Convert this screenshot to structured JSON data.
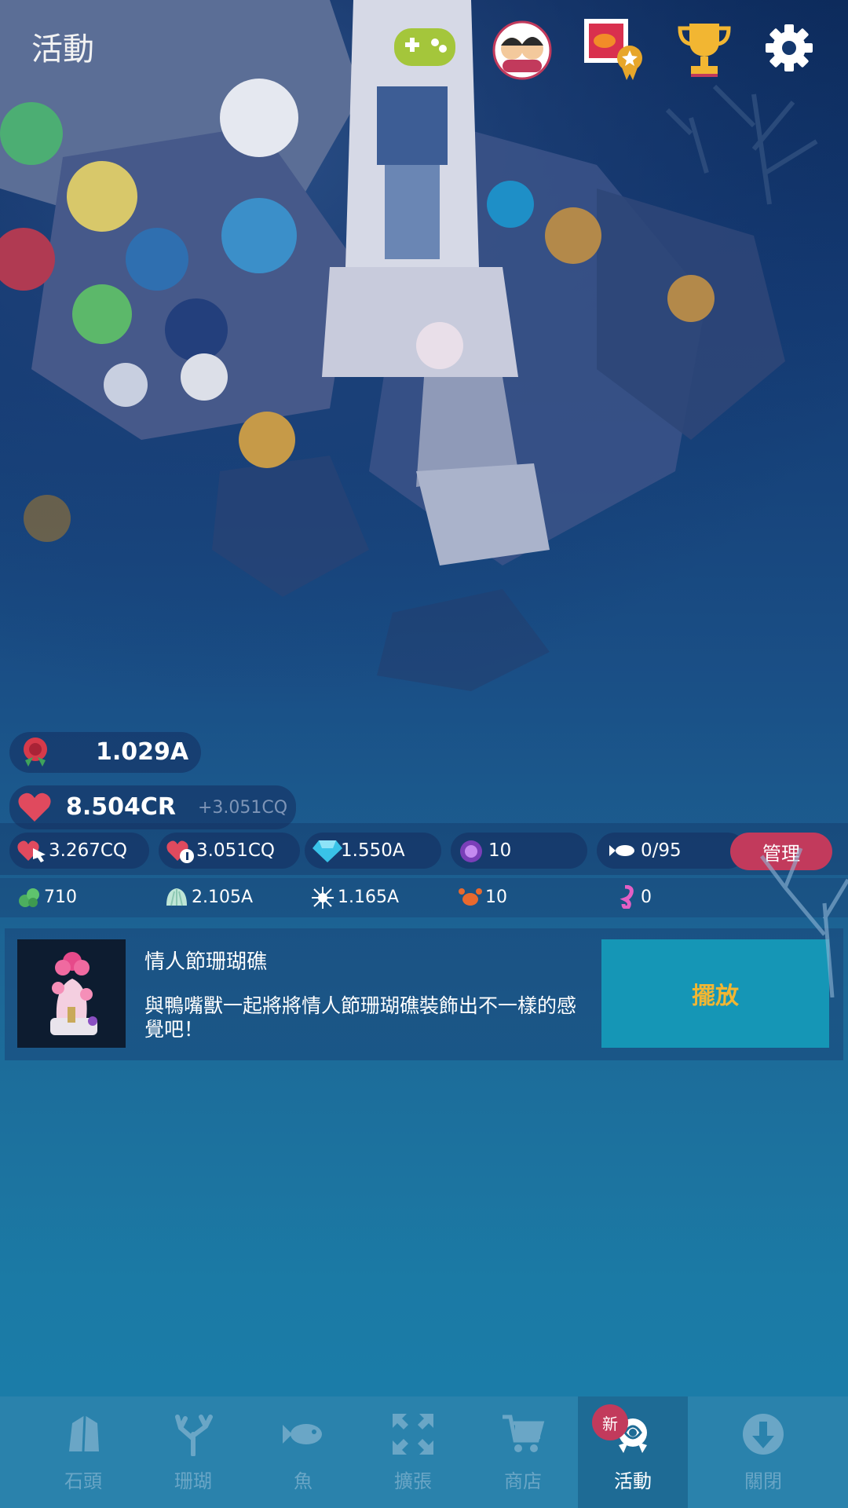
{
  "top_bar": {
    "title": "活動",
    "icons": [
      "gamepad-icon",
      "friends-icon",
      "fish-album-icon",
      "trophy-icon",
      "gear-icon"
    ]
  },
  "resources": {
    "rose": "1.029A",
    "heart": "8.504CR",
    "heart_rate": "+3.051CQ",
    "tap_heart": "3.267CQ",
    "idle_heart": "3.051CQ",
    "diamond": "1.550A",
    "pearl": "10",
    "fish_count": "0/95",
    "manage_label": "管理",
    "stone": "710",
    "shell": "2.105A",
    "urchin": "1.165A",
    "crab": "10",
    "seahorse": "0"
  },
  "event": {
    "title": "情人節珊瑚礁",
    "description": "與鴨嘴獸一起將將情人節珊瑚礁裝飾出不一樣的感覺吧！",
    "action": "擺放"
  },
  "nav": {
    "items": [
      {
        "label": "石頭",
        "icon": "stone-icon"
      },
      {
        "label": "珊瑚",
        "icon": "coral-icon"
      },
      {
        "label": "魚",
        "icon": "fish-icon"
      },
      {
        "label": "擴張",
        "icon": "expand-icon"
      },
      {
        "label": "商店",
        "icon": "cart-icon"
      },
      {
        "label": "活動",
        "icon": "event-rose-icon",
        "badge": "新"
      },
      {
        "label": "關閉",
        "icon": "close-down-icon"
      }
    ]
  }
}
